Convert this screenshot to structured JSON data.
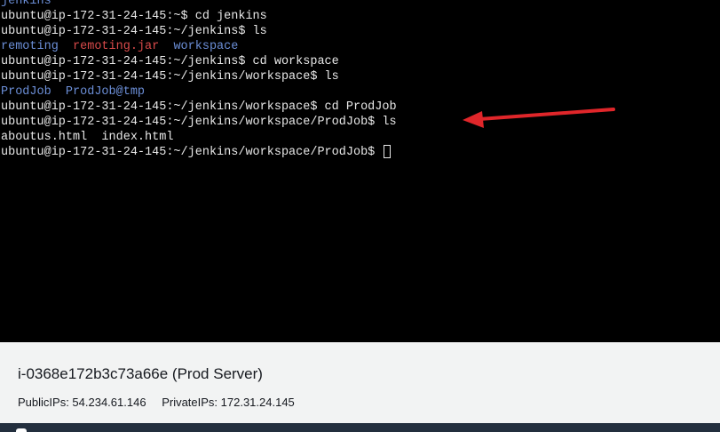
{
  "terminal": {
    "lines": [
      {
        "segments": [
          {
            "text": "jenkins",
            "kind": "dir"
          }
        ]
      },
      {
        "segments": [
          {
            "text": "ubuntu@ip-172-31-24-145:~$ cd jenkins",
            "kind": "plain"
          }
        ]
      },
      {
        "segments": [
          {
            "text": "ubuntu@ip-172-31-24-145:~/jenkins$ ls",
            "kind": "plain"
          }
        ]
      },
      {
        "segments": [
          {
            "text": "remoting",
            "kind": "dir"
          },
          {
            "text": "  ",
            "kind": "plain"
          },
          {
            "text": "remoting.jar",
            "kind": "exec"
          },
          {
            "text": "  ",
            "kind": "plain"
          },
          {
            "text": "workspace",
            "kind": "dir"
          }
        ]
      },
      {
        "segments": [
          {
            "text": "ubuntu@ip-172-31-24-145:~/jenkins$ cd workspace",
            "kind": "plain"
          }
        ]
      },
      {
        "segments": [
          {
            "text": "ubuntu@ip-172-31-24-145:~/jenkins/workspace$ ls",
            "kind": "plain"
          }
        ]
      },
      {
        "segments": [
          {
            "text": "ProdJob",
            "kind": "dir"
          },
          {
            "text": "  ",
            "kind": "plain"
          },
          {
            "text": "ProdJob@tmp",
            "kind": "dir"
          }
        ]
      },
      {
        "segments": [
          {
            "text": "ubuntu@ip-172-31-24-145:~/jenkins/workspace$ cd ProdJob",
            "kind": "plain"
          }
        ]
      },
      {
        "segments": [
          {
            "text": "ubuntu@ip-172-31-24-145:~/jenkins/workspace/ProdJob$ ls",
            "kind": "plain"
          }
        ]
      },
      {
        "segments": [
          {
            "text": "aboutus.html  index.html",
            "kind": "plain"
          }
        ]
      },
      {
        "segments": [
          {
            "text": "ubuntu@ip-172-31-24-145:~/jenkins/workspace/ProdJob$ ",
            "kind": "plain"
          }
        ],
        "cursor": true
      }
    ]
  },
  "annotation": {
    "arrow_color": "#e0262a",
    "icon": "red-arrow-icon"
  },
  "instance": {
    "title": "i-0368e172b3c73a66e (Prod Server)",
    "public_ips": "PublicIPs: 54.234.61.146",
    "private_ips": "PrivateIPs: 172.31.24.145"
  },
  "colors": {
    "terminal_bg": "#000000",
    "terminal_text": "#e8e8e8",
    "directory": "#6c8fd8",
    "executable": "#d84a4a",
    "panel_bg": "#f2f3f3",
    "bottom_bar": "#232f3e"
  }
}
